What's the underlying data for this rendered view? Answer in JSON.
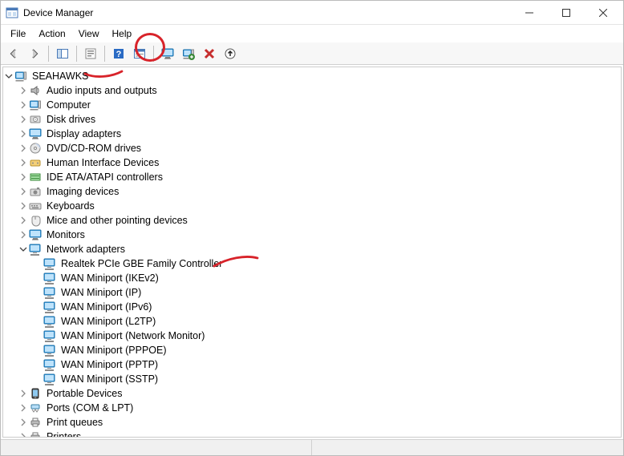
{
  "window": {
    "title": "Device Manager"
  },
  "menu": {
    "file": "File",
    "action": "Action",
    "view": "View",
    "help": "Help"
  },
  "toolbar": {
    "back": "Back",
    "forward": "Forward",
    "show_hide_tree": "Show/Hide Console Tree",
    "properties": "Properties",
    "help": "Help",
    "show_hidden": "Show hidden devices",
    "scan": "Scan for hardware changes",
    "add_legacy": "Add legacy hardware",
    "uninstall": "Uninstall device",
    "update": "Update device driver"
  },
  "tree": {
    "root": {
      "label": "SEAHAWKS",
      "icon": "computer-root-icon",
      "expanded": true
    },
    "categories": [
      {
        "label": "Audio inputs and outputs",
        "icon": "audio-icon",
        "expanded": false
      },
      {
        "label": "Computer",
        "icon": "computer-icon",
        "expanded": false
      },
      {
        "label": "Disk drives",
        "icon": "disk-icon",
        "expanded": false
      },
      {
        "label": "Display adapters",
        "icon": "display-icon",
        "expanded": false
      },
      {
        "label": "DVD/CD-ROM drives",
        "icon": "dvd-icon",
        "expanded": false
      },
      {
        "label": "Human Interface Devices",
        "icon": "hid-icon",
        "expanded": false
      },
      {
        "label": "IDE ATA/ATAPI controllers",
        "icon": "ide-icon",
        "expanded": false
      },
      {
        "label": "Imaging devices",
        "icon": "imaging-icon",
        "expanded": false
      },
      {
        "label": "Keyboards",
        "icon": "keyboard-icon",
        "expanded": false
      },
      {
        "label": "Mice and other pointing devices",
        "icon": "mouse-icon",
        "expanded": false
      },
      {
        "label": "Monitors",
        "icon": "monitor-icon",
        "expanded": false
      },
      {
        "label": "Network adapters",
        "icon": "network-icon",
        "expanded": true,
        "children": [
          {
            "label": "Realtek PCIe GBE Family Controller",
            "icon": "network-icon"
          },
          {
            "label": "WAN Miniport (IKEv2)",
            "icon": "network-icon"
          },
          {
            "label": "WAN Miniport (IP)",
            "icon": "network-icon"
          },
          {
            "label": "WAN Miniport (IPv6)",
            "icon": "network-icon"
          },
          {
            "label": "WAN Miniport (L2TP)",
            "icon": "network-icon"
          },
          {
            "label": "WAN Miniport (Network Monitor)",
            "icon": "network-icon"
          },
          {
            "label": "WAN Miniport (PPPOE)",
            "icon": "network-icon"
          },
          {
            "label": "WAN Miniport (PPTP)",
            "icon": "network-icon"
          },
          {
            "label": "WAN Miniport (SSTP)",
            "icon": "network-icon"
          }
        ]
      },
      {
        "label": "Portable Devices",
        "icon": "portable-icon",
        "expanded": false
      },
      {
        "label": "Ports (COM & LPT)",
        "icon": "ports-icon",
        "expanded": false
      },
      {
        "label": "Print queues",
        "icon": "printq-icon",
        "expanded": false
      },
      {
        "label": "Printers",
        "icon": "print-icon",
        "expanded": false
      }
    ]
  },
  "annotations": {
    "circle_toolbar": true,
    "underline_root": true,
    "arrow_realtek": true
  }
}
